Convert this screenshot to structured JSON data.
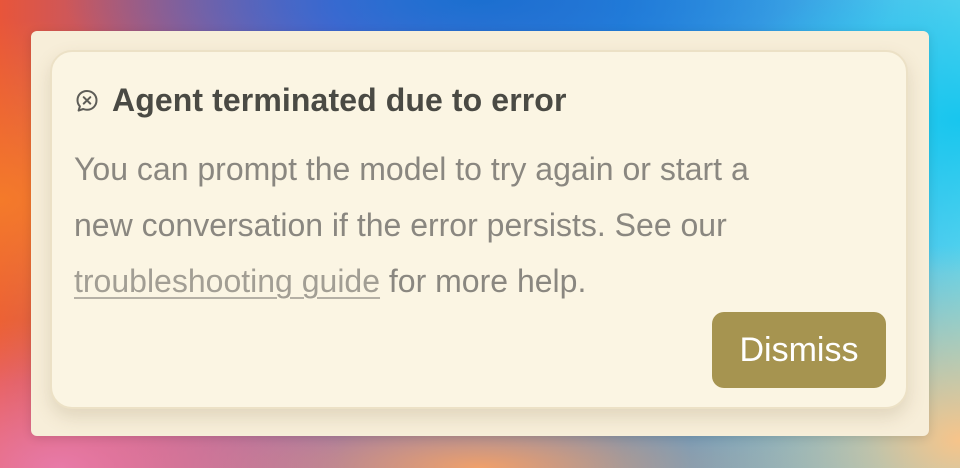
{
  "dialog": {
    "title": "Agent terminated due to error",
    "title_icon": "error-chat-bubble-icon",
    "message": {
      "line1": "You can prompt the model to try again or start a",
      "line2": "new conversation if the error persists. See our",
      "link_text": "troubleshooting guide",
      "after_link": " for more help."
    },
    "dismiss_label": "Dismiss"
  },
  "colors": {
    "accent_button": "#a69450",
    "card_background": "#fbf5e3",
    "title_text": "#4a4a44",
    "body_text": "#8a8780"
  }
}
